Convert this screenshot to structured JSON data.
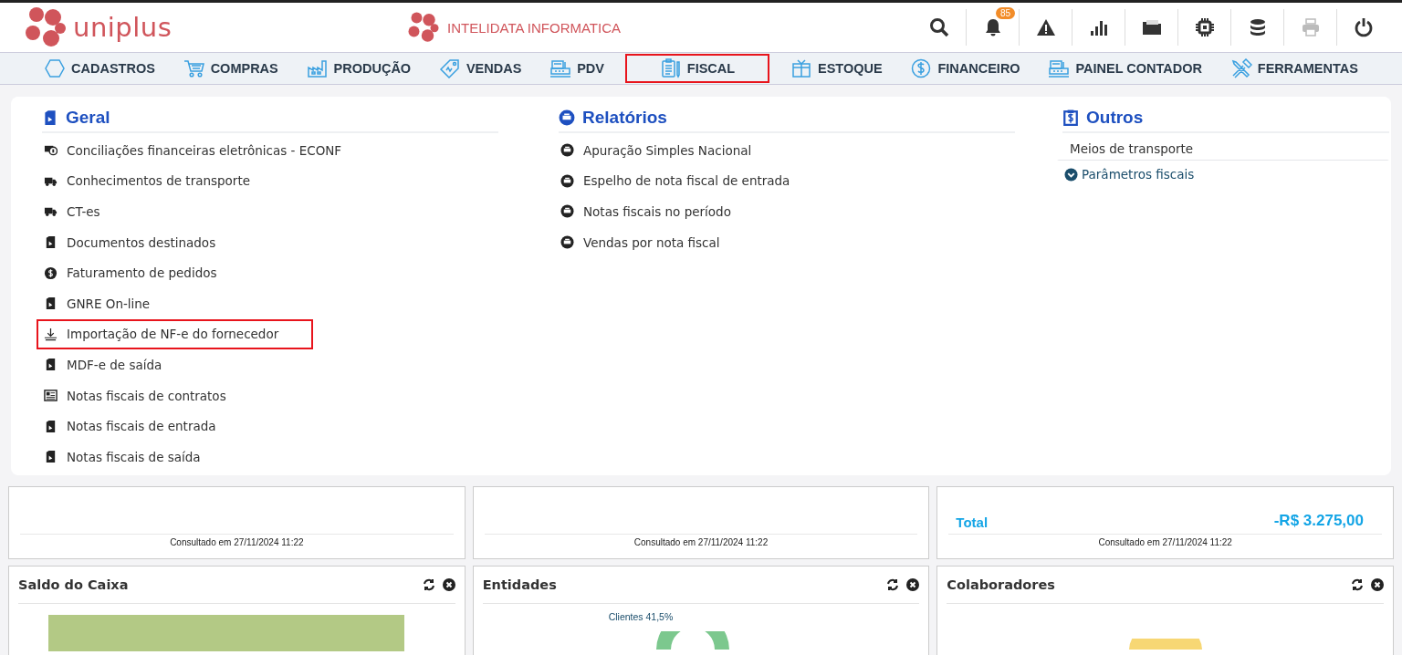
{
  "header": {
    "logo_text": "uniplus",
    "company": "INTELIDATA INFORMATICA",
    "toolbar": [
      {
        "kind": "search",
        "disabled": false
      },
      {
        "kind": "notifications",
        "badge": "85",
        "disabled": false
      },
      {
        "kind": "warning",
        "disabled": false
      },
      {
        "kind": "chart",
        "disabled": false
      },
      {
        "kind": "folder",
        "disabled": false
      },
      {
        "kind": "chip",
        "disabled": false
      },
      {
        "kind": "database",
        "disabled": false
      },
      {
        "kind": "print",
        "disabled": true
      },
      {
        "kind": "power",
        "disabled": false
      }
    ]
  },
  "nav": [
    {
      "label": "CADASTROS",
      "kind": "hexagon",
      "highlighted": false
    },
    {
      "label": "COMPRAS",
      "kind": "cart",
      "highlighted": false
    },
    {
      "label": "PRODUÇÃO",
      "kind": "factory",
      "highlighted": false
    },
    {
      "label": "VENDAS",
      "kind": "tag",
      "highlighted": false
    },
    {
      "label": "PDV",
      "kind": "register",
      "highlighted": false
    },
    {
      "label": "FISCAL",
      "kind": "clipboard",
      "highlighted": true
    },
    {
      "label": "ESTOQUE",
      "kind": "box",
      "highlighted": false
    },
    {
      "label": "FINANCEIRO",
      "kind": "dollar",
      "highlighted": false
    },
    {
      "label": "PAINEL CONTADOR",
      "kind": "register",
      "highlighted": false
    },
    {
      "label": "FERRAMENTAS",
      "kind": "tools",
      "highlighted": false
    }
  ],
  "menu": {
    "columns": [
      {
        "title": "Geral",
        "kind": "document",
        "items": [
          {
            "label": "Conciliações financeiras eletrônicas - ECONF",
            "kind": "money",
            "highlighted": false
          },
          {
            "label": "Conhecimentos de transporte",
            "kind": "truck",
            "highlighted": false
          },
          {
            "label": "CT-es",
            "kind": "truck",
            "highlighted": false
          },
          {
            "label": "Documentos destinados",
            "kind": "document",
            "highlighted": false
          },
          {
            "label": "Faturamento de pedidos",
            "kind": "coin",
            "highlighted": false
          },
          {
            "label": "GNRE On-line",
            "kind": "document",
            "highlighted": false
          },
          {
            "label": "Importação de NF-e do fornecedor",
            "kind": "download",
            "highlighted": true
          },
          {
            "label": "MDF-e de saída",
            "kind": "document",
            "highlighted": false
          },
          {
            "label": "Notas fiscais de contratos",
            "kind": "newspaper",
            "highlighted": false
          },
          {
            "label": "Notas fiscais de entrada",
            "kind": "document",
            "highlighted": false
          },
          {
            "label": "Notas fiscais de saída",
            "kind": "document",
            "highlighted": false
          }
        ]
      },
      {
        "title": "Relatórios",
        "kind": "printer",
        "items": [
          {
            "label": "Apuração Simples Nacional",
            "kind": "printer",
            "highlighted": false
          },
          {
            "label": "Espelho de nota fiscal de entrada",
            "kind": "printer",
            "highlighted": false
          },
          {
            "label": "Notas fiscais no período",
            "kind": "printer",
            "highlighted": false
          },
          {
            "label": "Vendas por nota fiscal",
            "kind": "printer",
            "highlighted": false
          }
        ]
      },
      {
        "title": "Outros",
        "kind": "receipt",
        "items": [
          {
            "label": "Meios de transporte",
            "kind": "plain",
            "highlighted": false
          },
          {
            "label": "Parâmetros fiscais",
            "kind": "expand",
            "highlighted": false
          }
        ]
      }
    ]
  },
  "dashboard": {
    "top_cards": [
      {
        "consulted": "Consultado em 27/11/2024 11:22"
      },
      {
        "consulted": "Consultado em 27/11/2024 11:22"
      },
      {
        "total_label": "Total",
        "total_value": "-R$ 3.275,00",
        "consulted": "Consultado em 27/11/2024 11:22"
      }
    ],
    "widgets": [
      {
        "title": "Saldo do Caixa",
        "kind": "bar"
      },
      {
        "title": "Entidades",
        "kind": "donut",
        "slice_label": "Clientes 41,5%"
      },
      {
        "title": "Colaboradores",
        "kind": "pie"
      }
    ]
  }
}
